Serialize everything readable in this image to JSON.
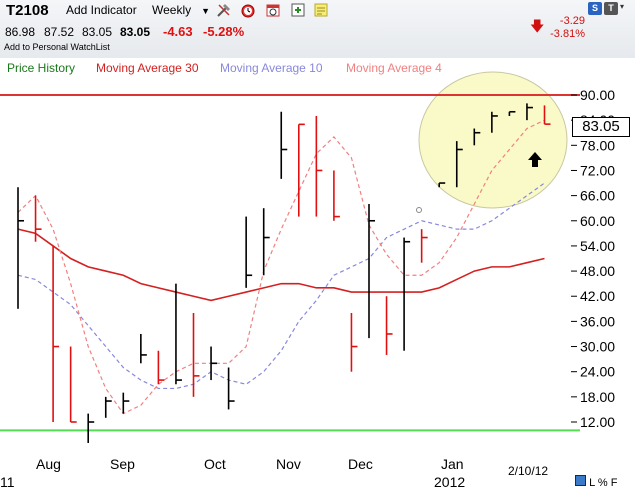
{
  "toolbar": {
    "ticker": "T2108",
    "add_indicator": "Add Indicator",
    "period": "Weekly",
    "icons": [
      "tools-icon",
      "alarm-clock-icon",
      "calendar-icon",
      "add-window-icon",
      "notes-icon"
    ],
    "quote": {
      "open": "86.98",
      "high": "87.52",
      "low": "83.05",
      "last": "83.05",
      "change": "-4.63",
      "change_pct": "-5.28%"
    },
    "watchlist": "Add to Personal WatchList",
    "period_change": {
      "value": "-3.29",
      "pct": "-3.81%"
    },
    "corner_buttons": [
      "S",
      "T"
    ]
  },
  "legend": {
    "price_history": "Price History",
    "ma30": "Moving Average 30",
    "ma10": "Moving Average 10",
    "ma4": "Moving Average 4"
  },
  "colors": {
    "price_history": "#1a7a1a",
    "ma30": "#d42020",
    "ma10": "#8888dd",
    "ma4": "#f08080",
    "up": "#000000",
    "down": "#e01010",
    "green_line": "#55dd55",
    "red_line": "#dd3333",
    "ellipse": "#fafac8"
  },
  "current_price": "83.05",
  "date_label": "2/10/12",
  "year_label": "2012",
  "left_edge_label": "11",
  "bottom_icons": [
    "L",
    "%",
    "F"
  ],
  "chart_data": {
    "type": "bar",
    "title": "",
    "ylim": [
      6,
      93
    ],
    "y_ticks": [
      90,
      84,
      78,
      72,
      66,
      60,
      54,
      48,
      42,
      36,
      30,
      24,
      18,
      12
    ],
    "y_tick_labels": [
      "90.00",
      "84.00",
      "78.00",
      "72.00",
      "66.00",
      "60.00",
      "54.00",
      "48.00",
      "42.00",
      "36.00",
      "30.00",
      "24.00",
      "18.00",
      "12.00"
    ],
    "x_labels": [
      "Aug",
      "Sep",
      "Oct",
      "Nov",
      "Dec",
      "Jan"
    ],
    "reference_lines": [
      {
        "name": "upper",
        "value": 90,
        "color": "red"
      },
      {
        "name": "lower",
        "value": 10,
        "color": "green"
      }
    ],
    "ohlc": [
      {
        "high": 68,
        "low": 39,
        "close": 60,
        "dir": "up"
      },
      {
        "high": 66,
        "low": 55,
        "close": 58,
        "dir": "down"
      },
      {
        "high": 54,
        "low": 12,
        "close": 30,
        "dir": "down"
      },
      {
        "high": 30,
        "low": 12,
        "close": 12,
        "dir": "down"
      },
      {
        "high": 14,
        "low": 7,
        "close": 12,
        "dir": "up"
      },
      {
        "high": 18,
        "low": 13,
        "close": 17,
        "dir": "up"
      },
      {
        "high": 19,
        "low": 14,
        "close": 17,
        "dir": "up"
      },
      {
        "high": 33,
        "low": 26,
        "close": 28,
        "dir": "up"
      },
      {
        "high": 29,
        "low": 21,
        "close": 22,
        "dir": "down"
      },
      {
        "high": 45,
        "low": 21,
        "close": 22,
        "dir": "up"
      },
      {
        "high": 38,
        "low": 18,
        "close": 23,
        "dir": "down"
      },
      {
        "high": 30,
        "low": 22,
        "close": 26,
        "dir": "up"
      },
      {
        "high": 25,
        "low": 15,
        "close": 17,
        "dir": "up"
      },
      {
        "high": 61,
        "low": 44,
        "close": 47,
        "dir": "up"
      },
      {
        "high": 63,
        "low": 47,
        "close": 56,
        "dir": "up"
      },
      {
        "high": 86,
        "low": 70,
        "close": 77,
        "dir": "up"
      },
      {
        "high": 83,
        "low": 61,
        "close": 83,
        "dir": "down"
      },
      {
        "high": 85,
        "low": 61,
        "close": 72,
        "dir": "down"
      },
      {
        "high": 72,
        "low": 60,
        "close": 61,
        "dir": "down"
      },
      {
        "high": 38,
        "low": 24,
        "close": 30,
        "dir": "down"
      },
      {
        "high": 64,
        "low": 32,
        "close": 60,
        "dir": "up"
      },
      {
        "high": 42,
        "low": 28,
        "close": 33,
        "dir": "down"
      },
      {
        "high": 56,
        "low": 29,
        "close": 55,
        "dir": "up"
      },
      {
        "high": 58,
        "low": 50,
        "close": 56,
        "dir": "down"
      },
      {
        "high": 69,
        "low": 68,
        "close": 69,
        "dir": "up"
      },
      {
        "high": 79,
        "low": 68,
        "close": 77,
        "dir": "up"
      },
      {
        "high": 82,
        "low": 78,
        "close": 81,
        "dir": "up"
      },
      {
        "high": 86,
        "low": 81,
        "close": 85,
        "dir": "up"
      },
      {
        "high": 86,
        "low": 85,
        "close": 86,
        "dir": "up"
      },
      {
        "high": 88,
        "low": 84,
        "close": 87,
        "dir": "up"
      },
      {
        "high": 87.52,
        "low": 83.05,
        "close": 83.05,
        "dir": "down"
      }
    ],
    "series": [
      {
        "name": "Moving Average 30",
        "values": [
          58,
          57,
          54,
          51,
          49,
          48,
          47,
          45,
          44,
          43,
          42,
          41,
          42,
          43,
          44,
          45,
          45,
          44,
          44,
          43,
          43,
          43,
          43,
          43,
          44,
          46,
          48,
          49,
          49,
          50,
          51
        ]
      },
      {
        "name": "Moving Average 10",
        "values": [
          47,
          46,
          43,
          40,
          35,
          30,
          25,
          22,
          20,
          20,
          21,
          24,
          22,
          21,
          24,
          29,
          36,
          41,
          47,
          49,
          51,
          56,
          58,
          60,
          59,
          58,
          58,
          60,
          63,
          66,
          69
        ]
      },
      {
        "name": "Moving Average 4",
        "values": [
          62,
          66,
          58,
          45,
          30,
          20,
          14,
          16,
          21,
          24,
          26,
          26,
          26,
          30,
          48,
          58,
          67,
          76,
          80,
          75,
          59,
          52,
          47,
          47,
          50,
          56,
          64,
          72,
          77,
          82,
          84
        ]
      }
    ]
  }
}
